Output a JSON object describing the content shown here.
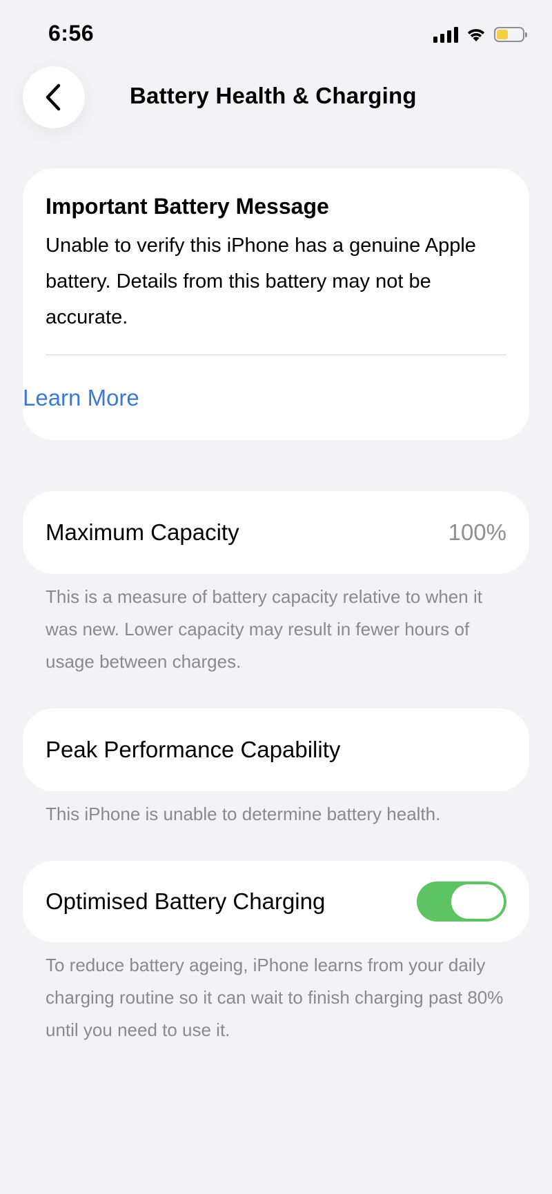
{
  "status_bar": {
    "time": "6:56",
    "icons": [
      "signal-icon",
      "wifi-icon",
      "battery-icon"
    ],
    "battery_color": "#f4d047"
  },
  "nav": {
    "back_icon": "chevron-left-icon",
    "title": "Battery Health & Charging"
  },
  "message_card": {
    "title": "Important Battery Message",
    "body": "Unable to verify this iPhone has a genuine Apple battery. Details from this battery may not be accurate.",
    "link_label": "Learn More",
    "link_color": "#3a79d6"
  },
  "maximum_capacity": {
    "label": "Maximum Capacity",
    "value": "100%",
    "footnote": "This is a measure of battery capacity relative to when it was new. Lower capacity may result in fewer hours of usage between charges."
  },
  "peak_performance": {
    "label": "Peak Performance Capability",
    "footnote": "This iPhone is unable to determine battery health."
  },
  "optimised_charging": {
    "label": "Optimised Battery Charging",
    "enabled": true,
    "toggle_color": "#5ec463",
    "footnote": "To reduce battery ageing, iPhone learns from your daily charging routine so it can wait to finish charging past 80% until you need to use it."
  }
}
